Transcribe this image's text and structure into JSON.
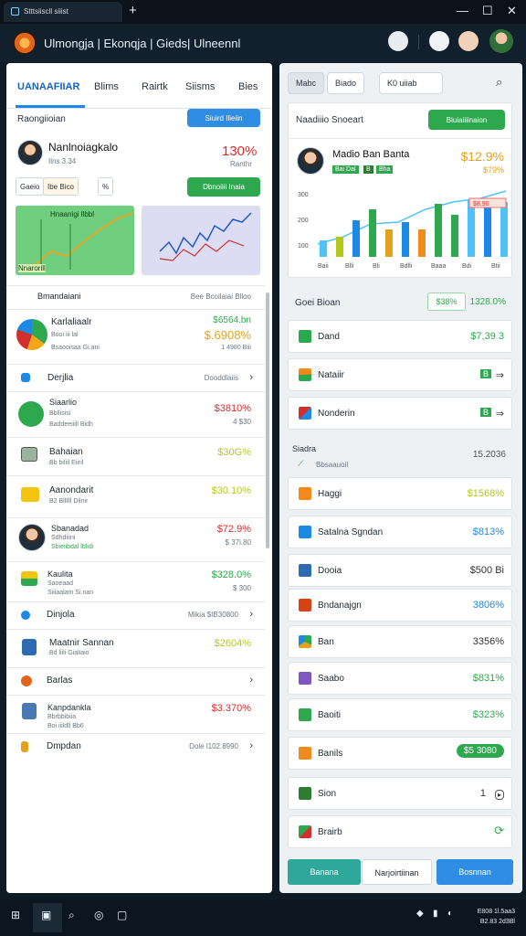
{
  "browser": {
    "tab_title": "Stttsiiscll siiist",
    "new_tab": "+",
    "minimize": "—",
    "maximize": "☐",
    "close": "✕"
  },
  "app": {
    "title": "Ulmongja | Ekonqja | Gieds| Ulneennl"
  },
  "left": {
    "nav": [
      "UANAAFIIAR",
      "Blims",
      "Rairtk",
      "Siisms",
      "Bies"
    ],
    "portfolio_title": "Raongiioian",
    "portfolio_button": "Siuird Ilieiin",
    "person_name": "Nanlnoiagkalo",
    "person_sub": "Ilns   3.34",
    "person_pct": "130%",
    "person_pct_sub": "Ranthr",
    "chips": [
      "Gaeio",
      "Ibe   Bico",
      "%"
    ],
    "green_button": "Dbnoiiii Inaia",
    "chart_left_label": "Hnaanigi llbbl",
    "chart_left_tag": "Nnarorill",
    "overview_title": "Bmandaiani",
    "overview_right": "Bee Bcoilaiai  Blloo",
    "rows": [
      {
        "label": "Karlaliaalr",
        "sub": "Booi iii   lal",
        "sub2": "Bsaooisaa  Gi.ani",
        "v1": "$6564.bn",
        "v2": "$.6908%",
        "v3": "1 4980  Biii"
      },
      {
        "label": "Derjlia",
        "sub": "",
        "right": "Dooddlaiis"
      },
      {
        "label": "Siaarlio",
        "sub": "Bbllisisi",
        "sub2": "Baddeeiiill  Bidh",
        "v1": "$3810%",
        "v2": "4 $30"
      },
      {
        "label": "Bahaian",
        "sub": "Bb biliil   Eiiril",
        "v1": "$30G%"
      },
      {
        "label": "Aanondarit",
        "sub": "B2 Bllllll  Dilnir",
        "v1": "$30.10%"
      },
      {
        "label": "Sbanadad",
        "sub": "Sdhdiiini",
        "sub2": "Sbieiibdal  lblidi",
        "v1": "$72.9%",
        "v2": "$ 37i.80"
      },
      {
        "label": "Kaulita",
        "sub": "Saoeaad",
        "sub2": "Siiiaalam  Si.nan",
        "v1": "$328.0%",
        "v2": "$ 300"
      },
      {
        "label": "Dinjola",
        "right": "Mikia  $IB30800"
      },
      {
        "label": "Maatnir Sannan",
        "sub": "Bd liili  Gialiaio",
        "v1": "$2604%"
      },
      {
        "label": "Barlas",
        "right": ""
      },
      {
        "label": "Kanpdankla",
        "sub": "Bbrbbibiia",
        "sub2": "Boi iiildll  Bb6",
        "v1": "$3.370%"
      },
      {
        "label": "Dmpdan",
        "right": "Dole  l102.8990"
      }
    ]
  },
  "right": {
    "segments": [
      "Mabc",
      "Biado",
      "K0 uiiab"
    ],
    "search_icon": "search-icon",
    "card_title": "Naadiiio Snoeart",
    "card_button": "Biuiaiiiinaion",
    "person_name": "Madio Ban Banta",
    "person_pct": "$12.9%",
    "person_pct_sub": "$79%",
    "badges": [
      "Bai Dal",
      "B",
      "Bha"
    ],
    "yticks": [
      "300",
      "200",
      "100"
    ],
    "xticks": [
      "Baii",
      "Blli",
      "Bli",
      "Bdlli",
      "Baaa",
      "Bdi",
      "Btii"
    ],
    "bar_tag": "$8.90",
    "summary_title": "Goei Bioan",
    "summary_pill": "$38%",
    "summary_val": "1328.0%",
    "rows": [
      {
        "label": "Dand",
        "value": "$7,39 3",
        "color": "#2ea84f"
      },
      {
        "label": "Nataiir",
        "value": "B",
        "color": "#2ea84f"
      },
      {
        "label": "Nonderin",
        "value": "B",
        "color": "#2ea84f"
      }
    ],
    "mid_title": "Siadra",
    "mid_sub": "Bbsaauoil",
    "mid_value": "15.2036",
    "rows2": [
      {
        "label": "Haggi",
        "value": "$1568%",
        "color": "#e3a21a"
      },
      {
        "label": "Satalna Sgndan",
        "value": "$813%",
        "color": "#1e88e5"
      },
      {
        "label": "Dooia",
        "value": "$500 Bi",
        "color": "#333"
      },
      {
        "label": "Bndanajgn",
        "value": "3806%",
        "color": "#1e88e5"
      },
      {
        "label": "Ban",
        "value": "3356%",
        "color": "#333"
      },
      {
        "label": "Saabo",
        "value": "$831%",
        "color": "#2ea84f"
      },
      {
        "label": "Baoiti",
        "value": "$323%",
        "color": "#2ea84f"
      },
      {
        "label": "Banils",
        "value": "$5 3080",
        "color": "#fff"
      },
      {
        "label": "Sion",
        "value": "1",
        "color": "#333"
      },
      {
        "label": "Brairb",
        "value": "",
        "color": "#2ea84f"
      }
    ],
    "bottom_buttons": [
      "Banana",
      "Narjoirtiinan",
      "Bosnnan"
    ]
  },
  "taskbar": {
    "time": "E808 1l.5aa3",
    "date": "B2.83 2d3Bl"
  }
}
